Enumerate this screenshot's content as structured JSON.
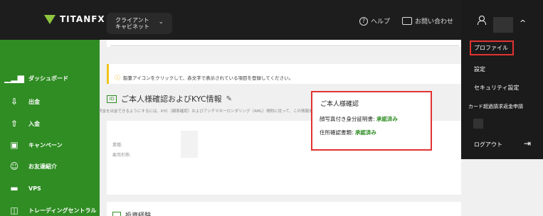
{
  "header": {
    "brand": "TITANFX",
    "cabinet_label_1": "クライアント",
    "cabinet_label_2": "キャビネット",
    "cabinet_chevron": "⌄",
    "help_label": "ヘルプ",
    "contact_label": "お問い合わせ"
  },
  "user_menu": {
    "chevron": "^",
    "items": {
      "profile": "プロファイル",
      "settings": "設定",
      "security": "セキュリティ設定",
      "card_refund": "カード超過請求返金申請",
      "logout": "ログアウト"
    }
  },
  "sidebar": {
    "items": [
      {
        "label": "ダッシュボード",
        "icon": "bar-chart-icon"
      },
      {
        "label": "出金",
        "icon": "withdraw-icon"
      },
      {
        "label": "入金",
        "icon": "deposit-icon"
      },
      {
        "label": "キャンペーン",
        "icon": "campaign-icon"
      },
      {
        "label": "お友達紹介",
        "icon": "referral-icon"
      },
      {
        "label": "VPS",
        "icon": "vps-icon"
      },
      {
        "label": "トレーディングセントラル",
        "icon": "trading-central-icon"
      }
    ]
  },
  "main": {
    "notice": "鉛筆アイコンをクリックして、赤文字で表示されている項目を登録してください。",
    "kyc_title": "ご本人様確認およびKYC情報",
    "kyc_description": "資金を出金できるようにするには、KYC（顧客確認）およびアンチマネーロンダリング（AML）規則に従って、この情報を提供することが義務付けられています。",
    "fields": {
      "occupation_label": "業種:",
      "employment_label": "雇用形態:"
    },
    "kyc_status": {
      "title": "ご本人様確認",
      "photo_id_label": "顔写真付き身分証明書:",
      "photo_id_status": "承認済み",
      "address_label": "住所確認書類:",
      "address_status": "承認済み"
    },
    "next_section_title": "投資経験"
  },
  "colors": {
    "sidebar_green": "#2f8d23",
    "highlight_red": "#e23232",
    "topbar": "#1d1d1d"
  }
}
